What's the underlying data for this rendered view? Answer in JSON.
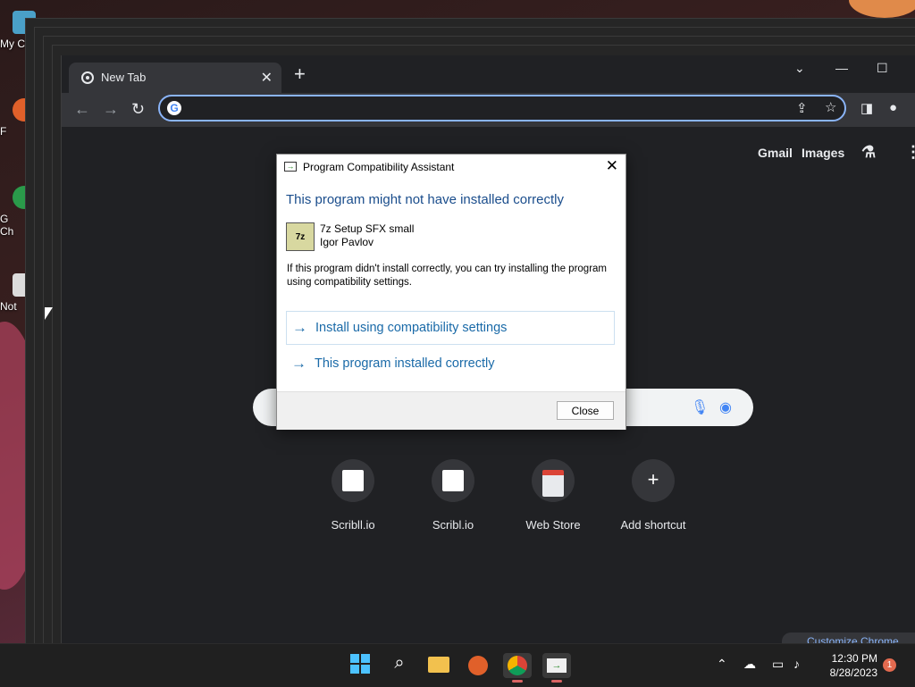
{
  "desktop": {
    "icons": [
      {
        "label": "My C"
      },
      {
        "label": "F"
      },
      {
        "label": "G"
      },
      {
        "label": "Ch"
      },
      {
        "label": "Not"
      }
    ]
  },
  "browser": {
    "tab_title": "New Tab",
    "omnibox_value": "",
    "ntp": {
      "gmail": "Gmail",
      "images": "Images",
      "shortcuts": [
        {
          "label": "Scribll.io"
        },
        {
          "label": "Scribl.io"
        },
        {
          "label": "Web Store"
        },
        {
          "label": "Add shortcut"
        }
      ],
      "customize": "Customize Chrome"
    }
  },
  "dialog": {
    "title": "Program Compatibility Assistant",
    "heading": "This program might not have installed correctly",
    "program_name": "7z Setup SFX small",
    "publisher": "Igor Pavlov",
    "message": "If this program didn't install correctly, you can try installing the program using compatibility settings.",
    "option1": "Install using compatibility settings",
    "option2": "This program installed correctly",
    "close_label": "Close"
  },
  "taskbar": {
    "time": "12:30 PM",
    "date": "8/28/2023",
    "notification_count": "1"
  }
}
